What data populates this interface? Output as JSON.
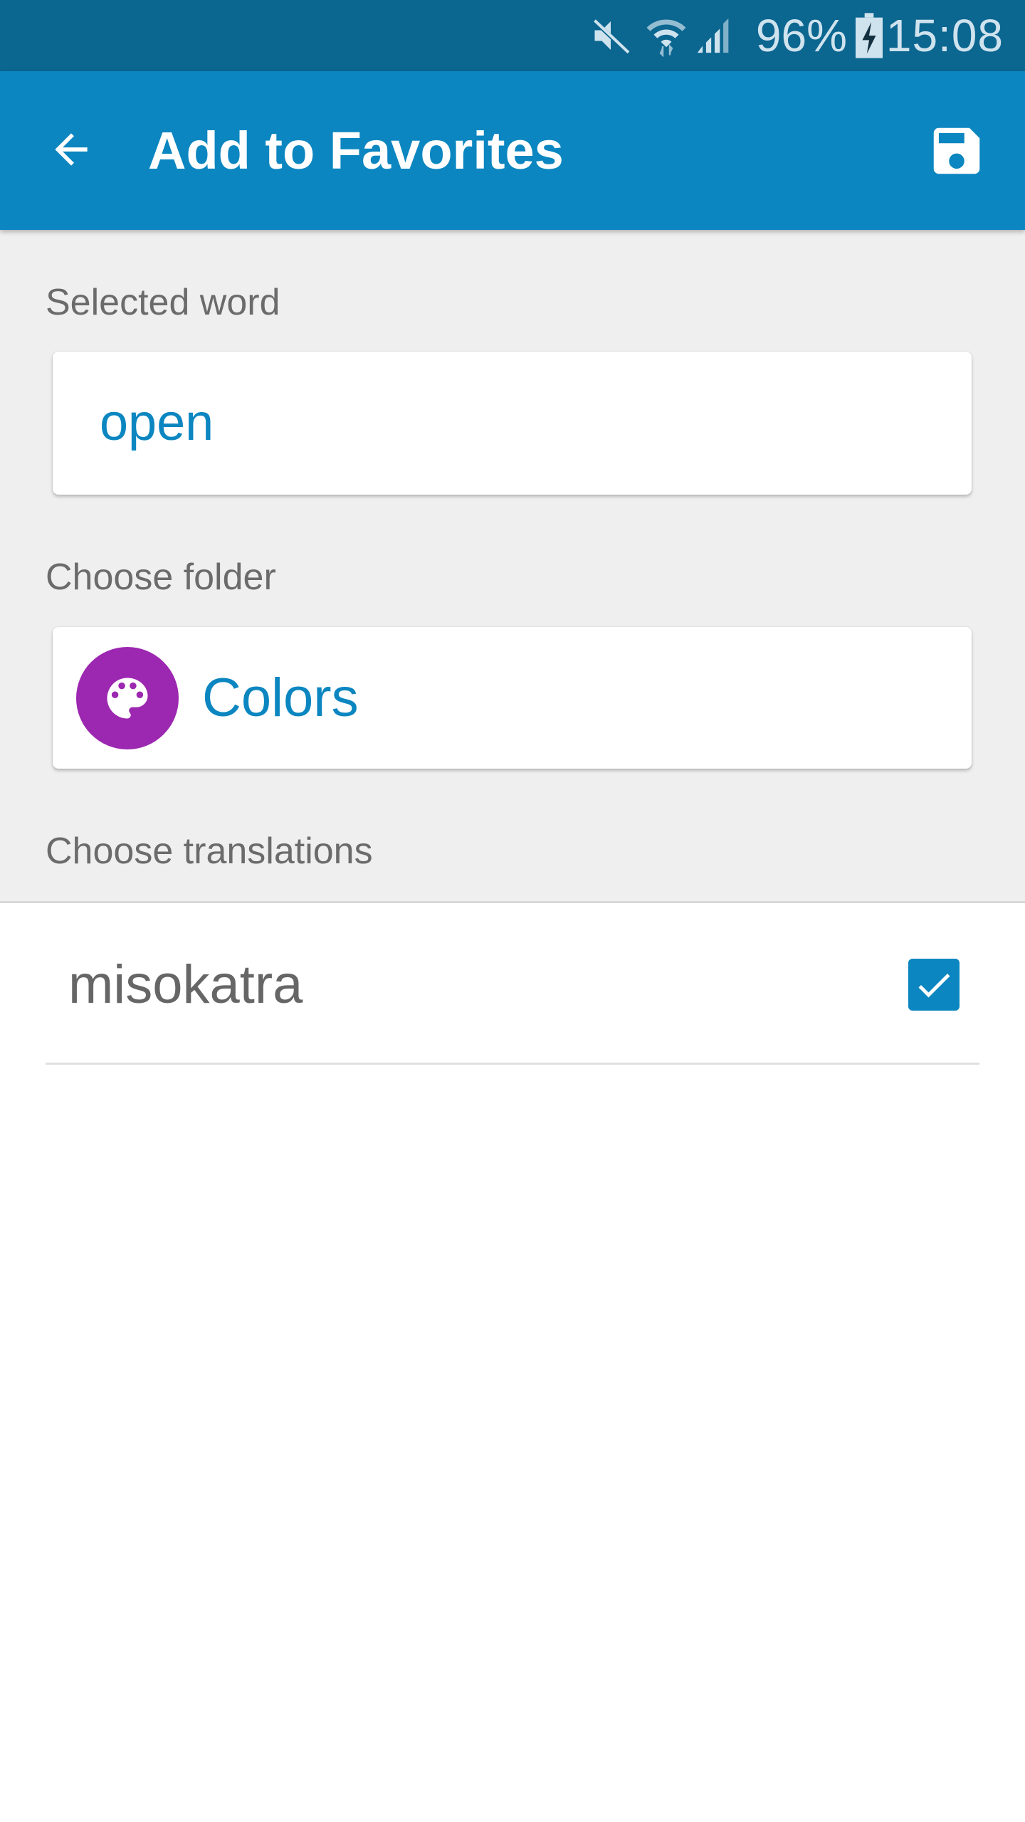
{
  "status_bar": {
    "icons": [
      "mute-icon",
      "wifi-icon",
      "signal-icon",
      "battery-charging-icon"
    ],
    "battery_percent": "96%",
    "time": "15:08"
  },
  "app_bar": {
    "back_icon": "arrow-back-icon",
    "title": "Add to Favorites",
    "save_icon": "save-icon"
  },
  "form": {
    "selected_word_label": "Selected word",
    "selected_word_value": "open",
    "choose_folder_label": "Choose folder",
    "folder": {
      "icon": "palette-icon",
      "icon_color": "#9c27b0",
      "name": "Colors"
    },
    "choose_translations_label": "Choose translations"
  },
  "translations": [
    {
      "text": "misokatra",
      "checked": true
    }
  ],
  "colors": {
    "status_bar": "#0b6690",
    "primary": "#0b86c0",
    "background": "#efefef",
    "label_text": "#6b6b6b"
  }
}
